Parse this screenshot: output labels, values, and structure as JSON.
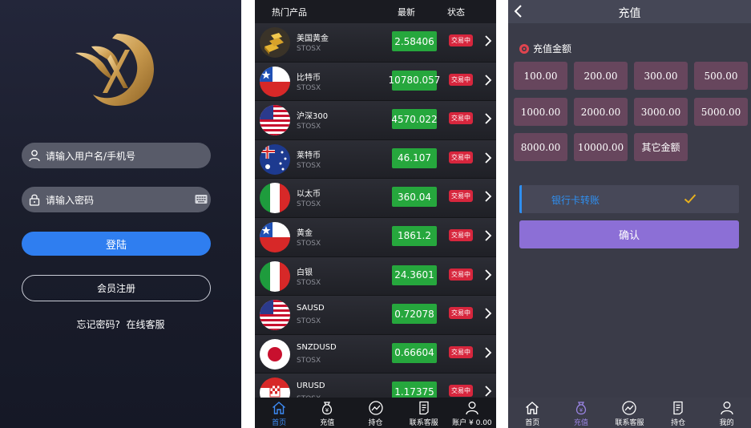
{
  "login": {
    "username_placeholder": "请输入用户名/手机号",
    "password_placeholder": "请输入密码",
    "login_button": "登陆",
    "register_button": "会员注册",
    "forgot_password": "忘记密码?",
    "online_service": "在线客服"
  },
  "market": {
    "headers": {
      "product": "热门产品",
      "latest": "最新",
      "status": "状态"
    },
    "items": [
      {
        "name": "美国黄金",
        "sub": "STOSX",
        "price": "2.58406",
        "status": "交易中",
        "icon": "gold-bar-icon"
      },
      {
        "name": "比特币",
        "sub": "STOSX",
        "price": "10780.057",
        "status": "交易中",
        "icon": "chile-flag-icon"
      },
      {
        "name": "沪深300",
        "sub": "STOSX",
        "price": "4570.022",
        "status": "交易中",
        "icon": "us-flag-icon"
      },
      {
        "name": "莱特币",
        "sub": "STOSX",
        "price": "46.107",
        "status": "交易中",
        "icon": "australia-flag-icon"
      },
      {
        "name": "以太币",
        "sub": "STOSX",
        "price": "360.04",
        "status": "交易中",
        "icon": "italy-flag-icon"
      },
      {
        "name": "黄金",
        "sub": "STOSX",
        "price": "1861.2",
        "status": "交易中",
        "icon": "chile-flag-icon"
      },
      {
        "name": "白银",
        "sub": "STOSX",
        "price": "24.3601",
        "status": "交易中",
        "icon": "italy-flag-icon"
      },
      {
        "name": "SAUSD",
        "sub": "STOSX",
        "price": "0.72078",
        "status": "交易中",
        "icon": "us-flag-icon"
      },
      {
        "name": "SNZDUSD",
        "sub": "STOSX",
        "price": "0.66604",
        "status": "交易中",
        "icon": "japan-flag-icon"
      },
      {
        "name": "URUSD",
        "sub": "STOSX",
        "price": "1.17375",
        "status": "交易中",
        "icon": "croatia-flag-icon"
      }
    ],
    "tabs": [
      {
        "label": "首页",
        "icon": "home-icon"
      },
      {
        "label": "充值",
        "icon": "money-bag-icon"
      },
      {
        "label": "持仓",
        "icon": "chart-icon"
      },
      {
        "label": "联系客服",
        "icon": "document-icon"
      },
      {
        "label": "账户 ¥ 0.00",
        "icon": "user-icon"
      }
    ]
  },
  "recharge": {
    "title": "充值",
    "amount_label": "充值金额",
    "amounts": [
      "100.00",
      "200.00",
      "300.00",
      "500.00",
      "1000.00",
      "2000.00",
      "3000.00",
      "5000.00",
      "8000.00",
      "10000.00",
      "其它金额"
    ],
    "bank_transfer": "银行卡转账",
    "confirm": "确认",
    "tabs": [
      {
        "label": "首页",
        "icon": "home-icon"
      },
      {
        "label": "充值",
        "icon": "money-bag-icon"
      },
      {
        "label": "联系客服",
        "icon": "chart-icon"
      },
      {
        "label": "持仓",
        "icon": "document-icon"
      },
      {
        "label": "我的",
        "icon": "user-icon"
      }
    ]
  },
  "colors": {
    "login_button": "#2f7ef0",
    "price_bg": "#26a73d",
    "status_bg": "#d7263d",
    "amount_bg": "#67465d",
    "confirm_bg": "#8c6fd6",
    "bank_accent": "#2f8ff0"
  }
}
